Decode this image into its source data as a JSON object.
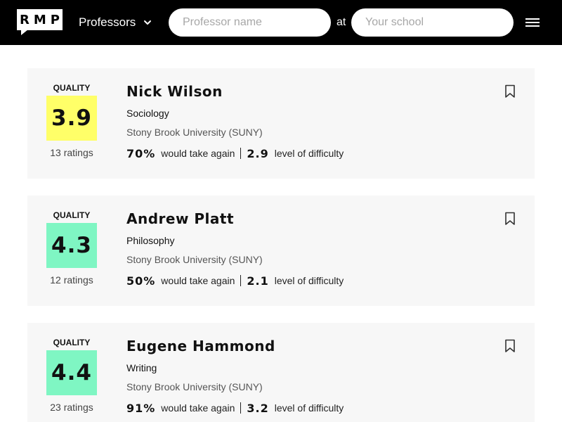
{
  "header": {
    "logo_text": "RMP",
    "search_type": "Professors",
    "professor_placeholder": "Professor name",
    "at_label": "at",
    "school_placeholder": "Your school"
  },
  "colors": {
    "topbar": "#000000",
    "card_bg": "#f7f7f7",
    "score_yellow": "#ffff68",
    "score_green": "#7ff6c3"
  },
  "results": [
    {
      "quality_label": "QUALITY",
      "score": "3.9",
      "score_color": "#ffff68",
      "ratings": "13 ratings",
      "name": "Nick Wilson",
      "department": "Sociology",
      "school": "Stony Brook University (SUNY)",
      "take_again": "70%",
      "take_again_label": "would take again",
      "difficulty": "2.9",
      "difficulty_label": "level of difficulty"
    },
    {
      "quality_label": "QUALITY",
      "score": "4.3",
      "score_color": "#7ff6c3",
      "ratings": "12 ratings",
      "name": "Andrew Platt",
      "department": "Philosophy",
      "school": "Stony Brook University (SUNY)",
      "take_again": "50%",
      "take_again_label": "would take again",
      "difficulty": "2.1",
      "difficulty_label": "level of difficulty"
    },
    {
      "quality_label": "QUALITY",
      "score": "4.4",
      "score_color": "#7ff6c3",
      "ratings": "23 ratings",
      "name": "Eugene Hammond",
      "department": "Writing",
      "school": "Stony Brook University (SUNY)",
      "take_again": "91%",
      "take_again_label": "would take again",
      "difficulty": "3.2",
      "difficulty_label": "level of difficulty"
    }
  ]
}
